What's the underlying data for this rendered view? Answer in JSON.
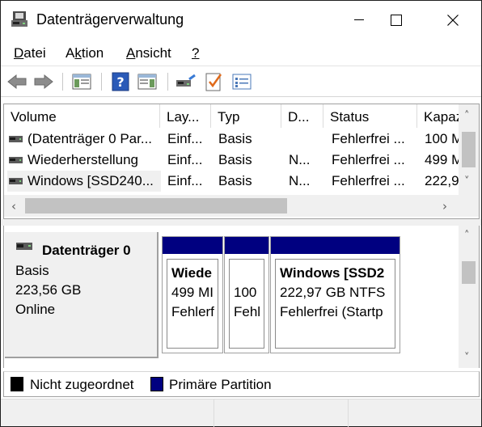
{
  "window": {
    "title": "Datenträgerverwaltung"
  },
  "menu": [
    {
      "label": "Datei",
      "accel": "D",
      "rest": "atei"
    },
    {
      "label": "Aktion",
      "pre": "A",
      "accel": "k",
      "rest": "tion"
    },
    {
      "label": "Ansicht",
      "accel": "A",
      "rest": "nsicht"
    },
    {
      "label": "?",
      "accel": "?",
      "rest": ""
    }
  ],
  "table": {
    "columns": [
      "Volume",
      "Lay...",
      "Typ",
      "D...",
      "Status",
      "Kapaz"
    ],
    "rows": [
      {
        "volume": "(Datenträger 0 Par...",
        "layout": "Einf...",
        "typ": "Basis",
        "dateisystem": "",
        "status": "Fehlerfrei ...",
        "kapazitaet": "100 M"
      },
      {
        "volume": "Wiederherstellung",
        "layout": "Einf...",
        "typ": "Basis",
        "dateisystem": "N...",
        "status": "Fehlerfrei ...",
        "kapazitaet": "499 M"
      },
      {
        "volume": "Windows [SSD240...",
        "layout": "Einf...",
        "typ": "Basis",
        "dateisystem": "N...",
        "status": "Fehlerfrei ...",
        "kapazitaet": "222,9"
      }
    ]
  },
  "disk": {
    "name": "Datenträger 0",
    "type": "Basis",
    "size": "223,56 GB",
    "state": "Online"
  },
  "partitions": [
    {
      "lines": [
        "Wiede",
        "499 MI",
        "Fehlerf"
      ]
    },
    {
      "lines": [
        "",
        "100",
        "Fehl"
      ]
    },
    {
      "lines": [
        "Windows [SSD2",
        "222,97 GB NTFS",
        "Fehlerfrei (Startp"
      ]
    }
  ],
  "legend": [
    {
      "label": "Nicht zugeordnet",
      "color": "#000000"
    },
    {
      "label": "Primäre Partition",
      "color": "#000080"
    }
  ],
  "icons": {
    "toolbar": [
      "back-arrow-icon",
      "forward-arrow-icon",
      "show-hide-console-tree-icon",
      "help-icon",
      "show-hide-action-pane-icon",
      "connect-virtual-disk-icon",
      "check-properties-icon",
      "list-settings-icon"
    ]
  }
}
